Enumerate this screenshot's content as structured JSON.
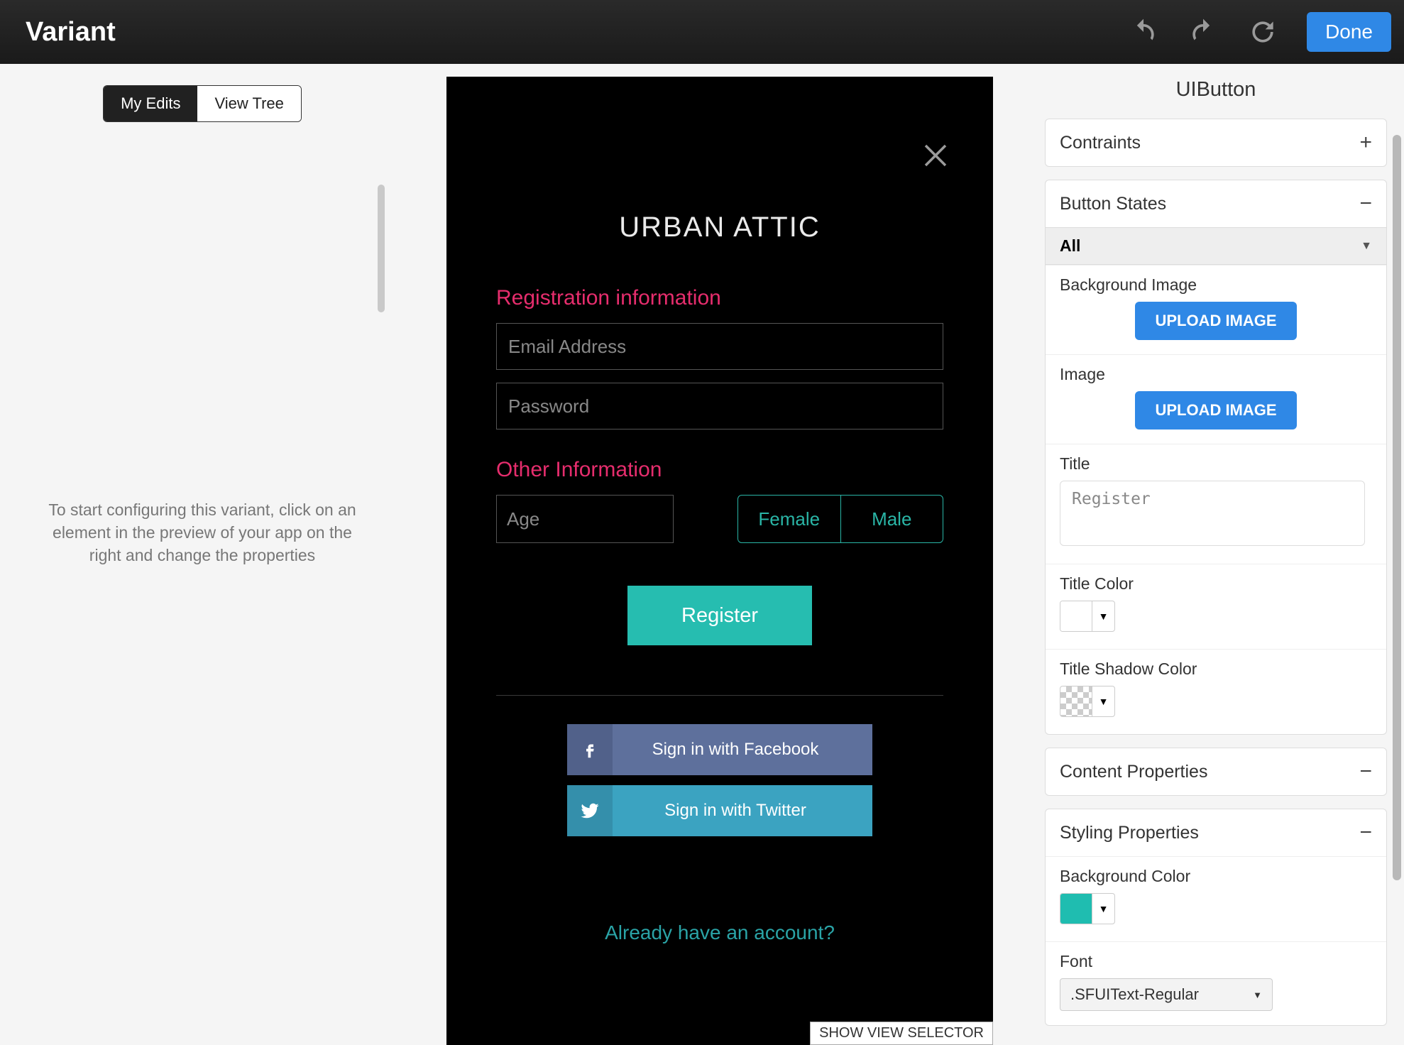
{
  "topbar": {
    "title": "Variant",
    "done_label": "Done"
  },
  "left": {
    "tab_my_edits": "My Edits",
    "tab_view_tree": "View Tree",
    "hint": "To start configuring this variant, click on an element in the preview of your app on the right and change the properties"
  },
  "phone": {
    "app_title": "URBAN ATTIC",
    "registration_label": "Registration information",
    "email_placeholder": "Email Address",
    "password_placeholder": "Password",
    "other_label": "Other Information",
    "age_placeholder": "Age",
    "gender_female": "Female",
    "gender_male": "Male",
    "register_label": "Register",
    "fb_label": "Sign in with Facebook",
    "tw_label": "Sign in with Twitter",
    "already_label": "Already have an account?",
    "show_selector": "SHOW VIEW SELECTOR"
  },
  "inspector": {
    "element_title": "UIButton",
    "constraints_label": "Contraints",
    "button_states_label": "Button States",
    "state_selected": "All",
    "bg_image_label": "Background Image",
    "image_label": "Image",
    "upload_label": "UPLOAD IMAGE",
    "title_label": "Title",
    "title_value": "Register",
    "title_color_label": "Title Color",
    "title_shadow_label": "Title Shadow Color",
    "content_props_label": "Content Properties",
    "styling_props_label": "Styling Properties",
    "bg_color_label": "Background Color",
    "font_label": "Font",
    "font_value": ".SFUIText-Regular",
    "colors": {
      "title_color": "#ffffff",
      "bg_color": "#1fbdb0"
    }
  }
}
